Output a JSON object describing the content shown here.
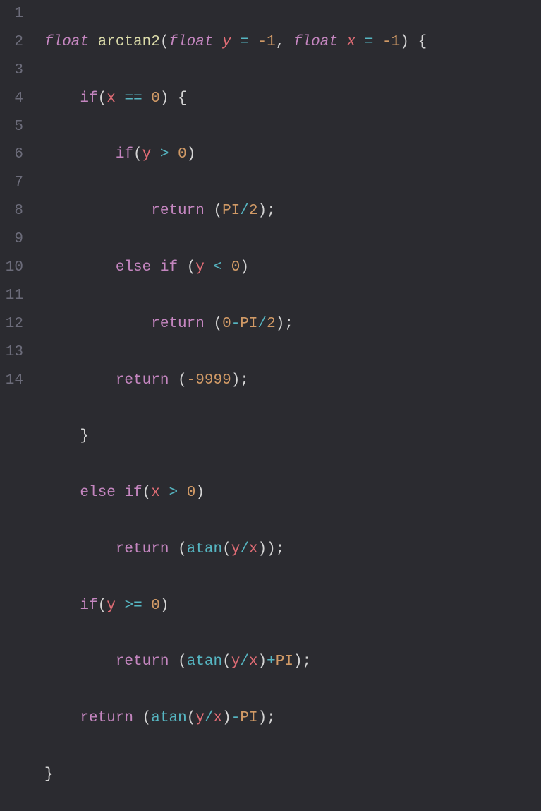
{
  "lineNumbers": [
    "1",
    "2",
    "3",
    "4",
    "5",
    "6",
    "7",
    "8",
    "9",
    "10",
    "11",
    "12",
    "13",
    "14"
  ],
  "tokens": {
    "float": "float",
    "arctan2": "arctan2",
    "y": "y",
    "x": "x",
    "neg1": "-1",
    "if": "if",
    "else": "else",
    "return": "return",
    "PI": "PI",
    "atan": "atan",
    "zero": "0",
    "two": "2",
    "neg9999": "-9999",
    "eq": "=",
    "eqeq": "==",
    "gt": ">",
    "lt": "<",
    "gte": ">=",
    "div": "/",
    "plus": "+",
    "minus": "-",
    "lparen": "(",
    "rparen": ")",
    "lbrace": "{",
    "rbrace": "}",
    "comma": ",",
    "semi": ";"
  }
}
